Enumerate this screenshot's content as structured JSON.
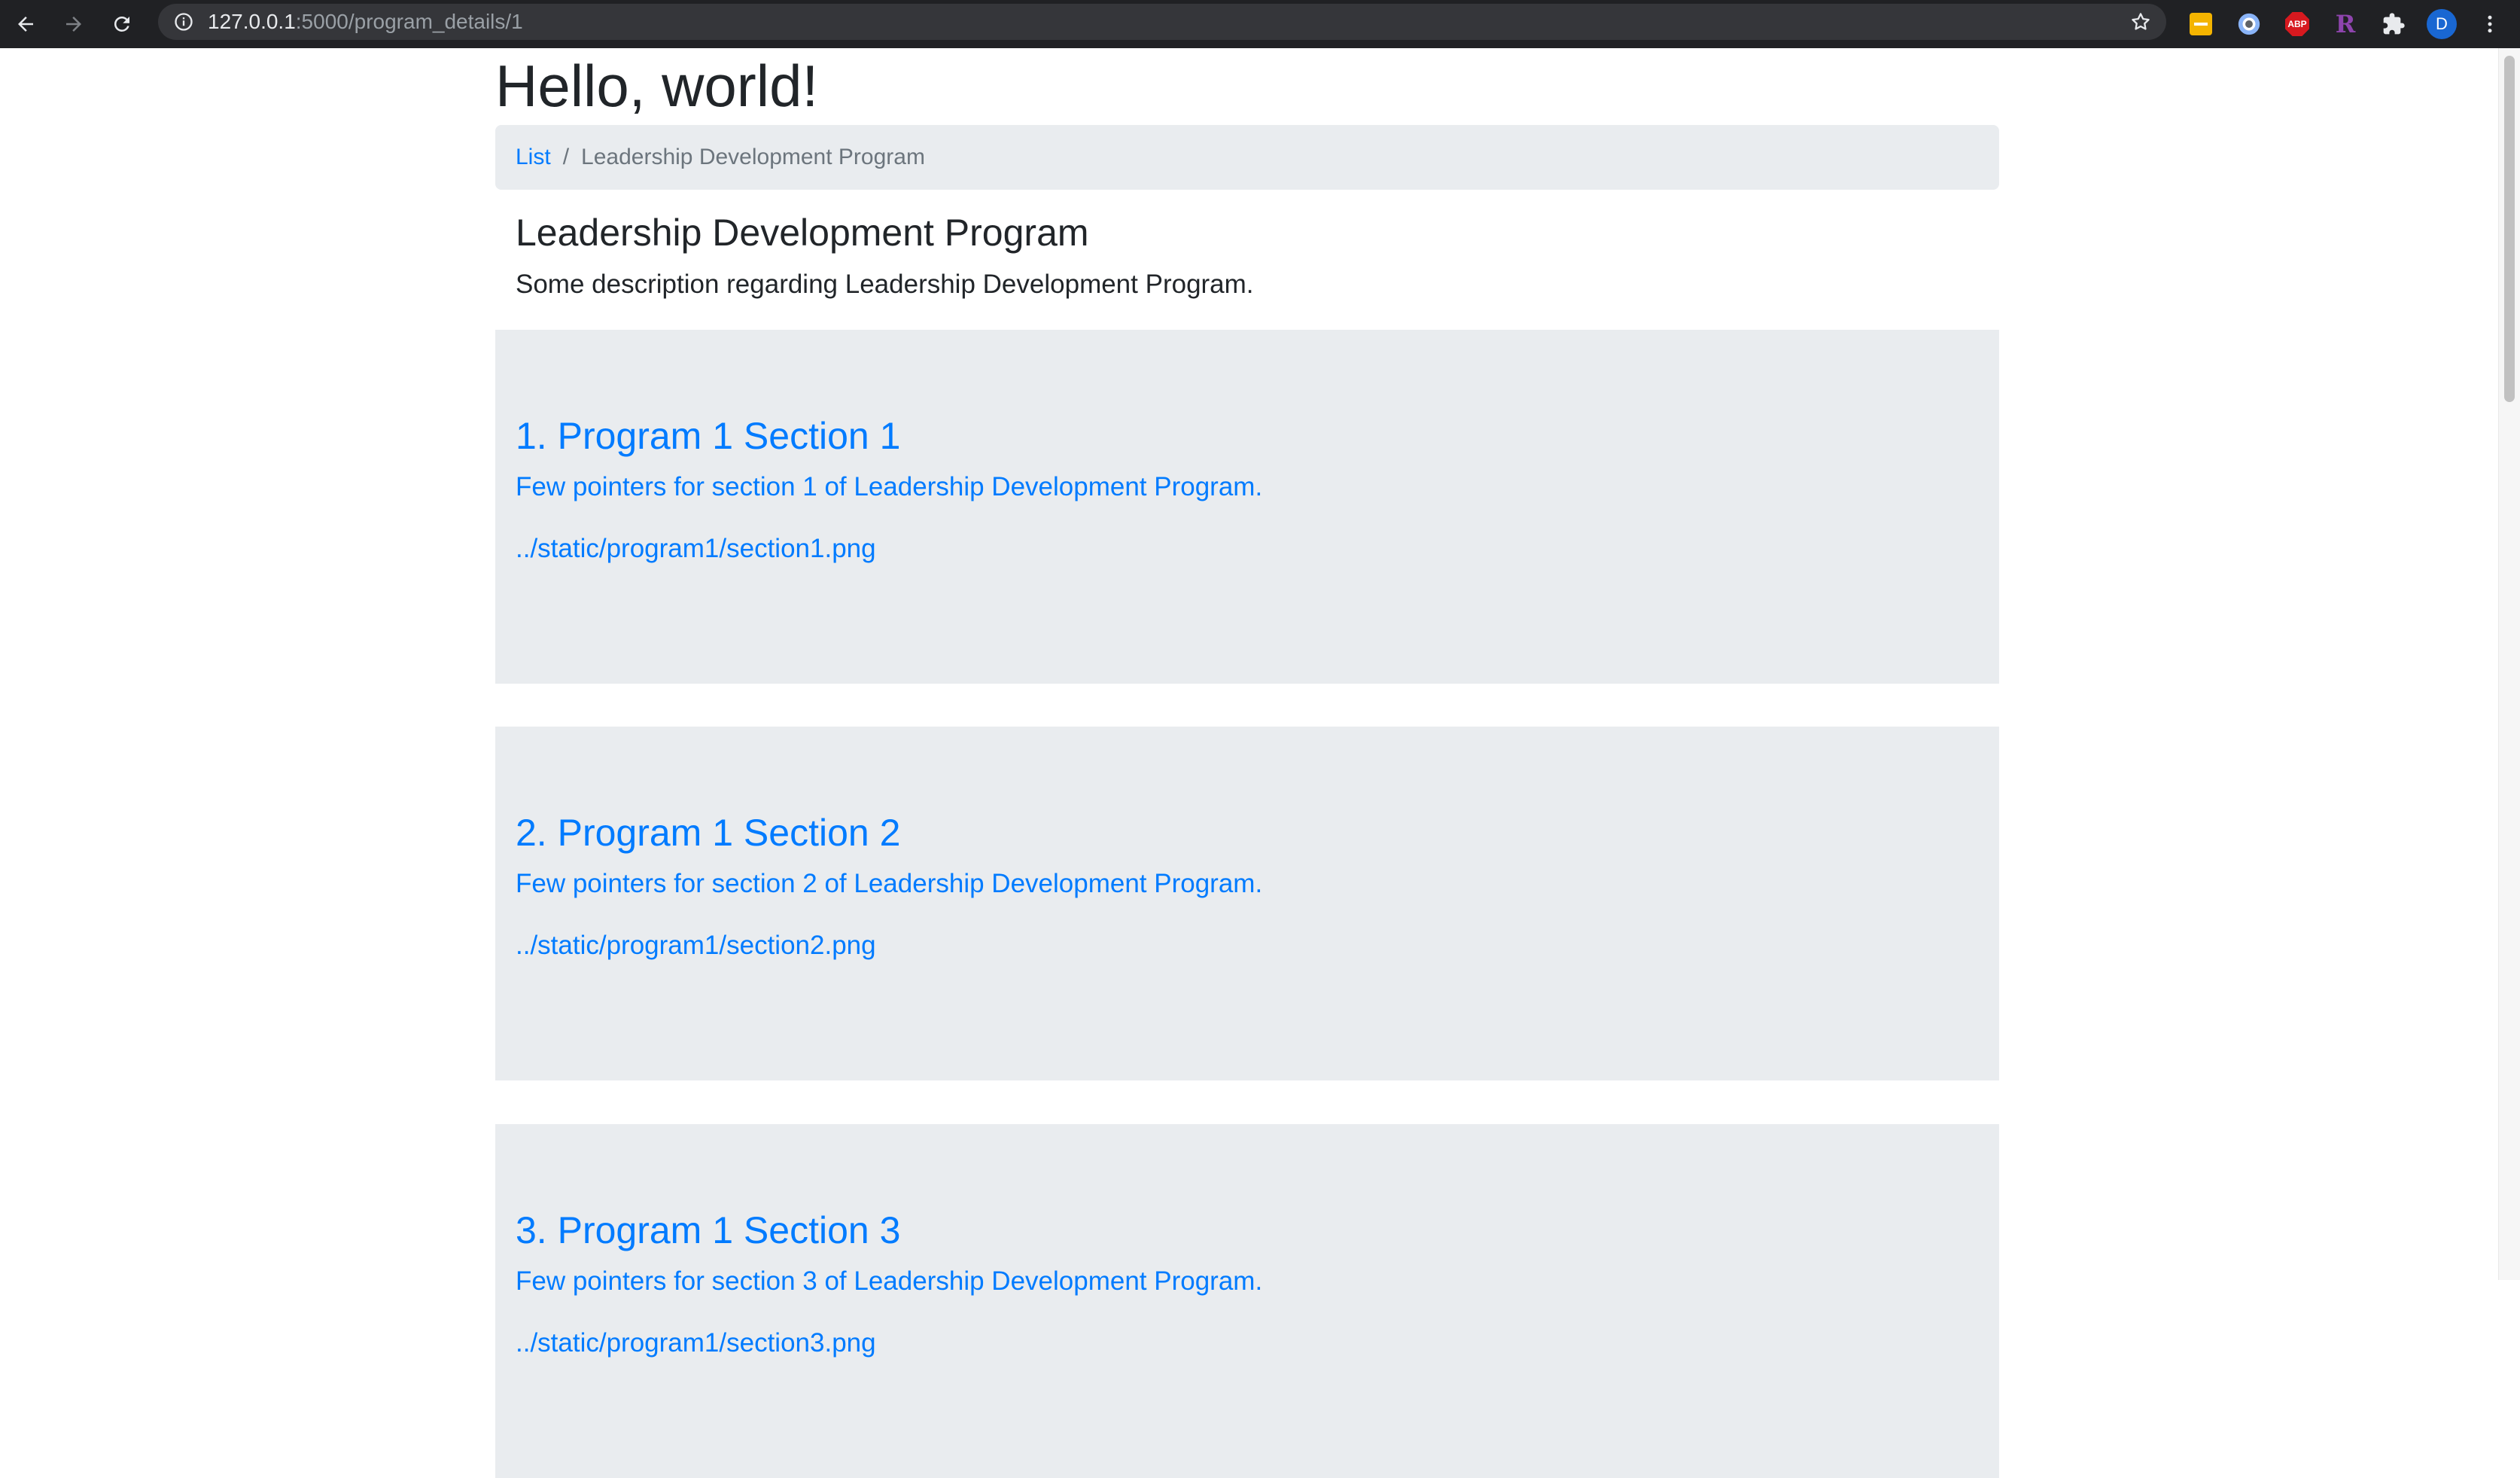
{
  "browser": {
    "url_host": "127.0.0.1",
    "url_path": ":5000/program_details/1",
    "avatar_letter": "D",
    "extensions": [
      "sticky-notes-icon",
      "circle-extension-icon",
      "abp-icon",
      "r-extension-icon",
      "puzzle-icon"
    ],
    "abp_label": "ABP",
    "r_label": "R"
  },
  "page": {
    "heading": "Hello, world!",
    "breadcrumb": {
      "link": "List",
      "separator": "/",
      "current": "Leadership Development Program"
    },
    "program": {
      "title": "Leadership Development Program",
      "description": "Some description regarding Leadership Development Program."
    },
    "sections": [
      {
        "title": "1. Program 1 Section 1",
        "description": "Few pointers for section 1 of Leadership Development Program.",
        "image_alt": "../static/program1/section1.png"
      },
      {
        "title": "2. Program 1 Section 2",
        "description": "Few pointers for section 2 of Leadership Development Program.",
        "image_alt": "../static/program1/section2.png"
      },
      {
        "title": "3. Program 1 Section 3",
        "description": "Few pointers for section 3 of Leadership Development Program.",
        "image_alt": "../static/program1/section3.png"
      }
    ]
  },
  "colors": {
    "link": "#007bff",
    "panel": "#e9ecef",
    "chrome": "#202124"
  }
}
